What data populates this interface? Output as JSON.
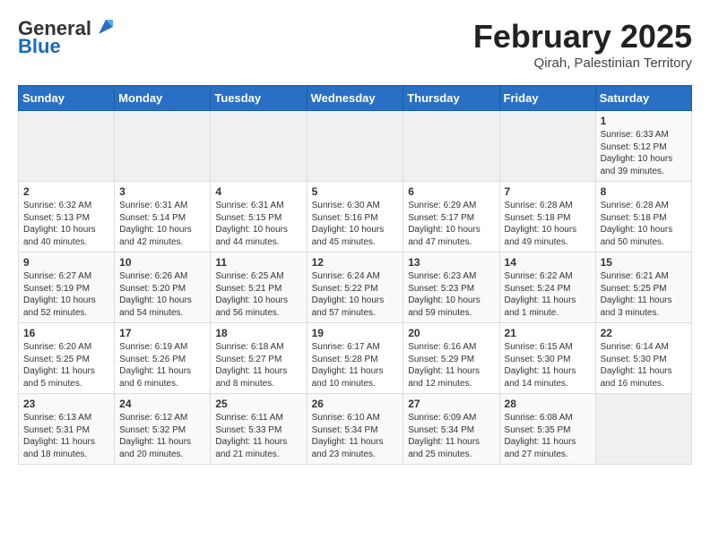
{
  "logo": {
    "general": "General",
    "blue": "Blue"
  },
  "header": {
    "month_year": "February 2025",
    "location": "Qirah, Palestinian Territory"
  },
  "weekdays": [
    "Sunday",
    "Monday",
    "Tuesday",
    "Wednesday",
    "Thursday",
    "Friday",
    "Saturday"
  ],
  "weeks": [
    [
      {
        "day": "",
        "content": ""
      },
      {
        "day": "",
        "content": ""
      },
      {
        "day": "",
        "content": ""
      },
      {
        "day": "",
        "content": ""
      },
      {
        "day": "",
        "content": ""
      },
      {
        "day": "",
        "content": ""
      },
      {
        "day": "1",
        "content": "Sunrise: 6:33 AM\nSunset: 5:12 PM\nDaylight: 10 hours and 39 minutes."
      }
    ],
    [
      {
        "day": "2",
        "content": "Sunrise: 6:32 AM\nSunset: 5:13 PM\nDaylight: 10 hours and 40 minutes."
      },
      {
        "day": "3",
        "content": "Sunrise: 6:31 AM\nSunset: 5:14 PM\nDaylight: 10 hours and 42 minutes."
      },
      {
        "day": "4",
        "content": "Sunrise: 6:31 AM\nSunset: 5:15 PM\nDaylight: 10 hours and 44 minutes."
      },
      {
        "day": "5",
        "content": "Sunrise: 6:30 AM\nSunset: 5:16 PM\nDaylight: 10 hours and 45 minutes."
      },
      {
        "day": "6",
        "content": "Sunrise: 6:29 AM\nSunset: 5:17 PM\nDaylight: 10 hours and 47 minutes."
      },
      {
        "day": "7",
        "content": "Sunrise: 6:28 AM\nSunset: 5:18 PM\nDaylight: 10 hours and 49 minutes."
      },
      {
        "day": "8",
        "content": "Sunrise: 6:28 AM\nSunset: 5:18 PM\nDaylight: 10 hours and 50 minutes."
      }
    ],
    [
      {
        "day": "9",
        "content": "Sunrise: 6:27 AM\nSunset: 5:19 PM\nDaylight: 10 hours and 52 minutes."
      },
      {
        "day": "10",
        "content": "Sunrise: 6:26 AM\nSunset: 5:20 PM\nDaylight: 10 hours and 54 minutes."
      },
      {
        "day": "11",
        "content": "Sunrise: 6:25 AM\nSunset: 5:21 PM\nDaylight: 10 hours and 56 minutes."
      },
      {
        "day": "12",
        "content": "Sunrise: 6:24 AM\nSunset: 5:22 PM\nDaylight: 10 hours and 57 minutes."
      },
      {
        "day": "13",
        "content": "Sunrise: 6:23 AM\nSunset: 5:23 PM\nDaylight: 10 hours and 59 minutes."
      },
      {
        "day": "14",
        "content": "Sunrise: 6:22 AM\nSunset: 5:24 PM\nDaylight: 11 hours and 1 minute."
      },
      {
        "day": "15",
        "content": "Sunrise: 6:21 AM\nSunset: 5:25 PM\nDaylight: 11 hours and 3 minutes."
      }
    ],
    [
      {
        "day": "16",
        "content": "Sunrise: 6:20 AM\nSunset: 5:25 PM\nDaylight: 11 hours and 5 minutes."
      },
      {
        "day": "17",
        "content": "Sunrise: 6:19 AM\nSunset: 5:26 PM\nDaylight: 11 hours and 6 minutes."
      },
      {
        "day": "18",
        "content": "Sunrise: 6:18 AM\nSunset: 5:27 PM\nDaylight: 11 hours and 8 minutes."
      },
      {
        "day": "19",
        "content": "Sunrise: 6:17 AM\nSunset: 5:28 PM\nDaylight: 11 hours and 10 minutes."
      },
      {
        "day": "20",
        "content": "Sunrise: 6:16 AM\nSunset: 5:29 PM\nDaylight: 11 hours and 12 minutes."
      },
      {
        "day": "21",
        "content": "Sunrise: 6:15 AM\nSunset: 5:30 PM\nDaylight: 11 hours and 14 minutes."
      },
      {
        "day": "22",
        "content": "Sunrise: 6:14 AM\nSunset: 5:30 PM\nDaylight: 11 hours and 16 minutes."
      }
    ],
    [
      {
        "day": "23",
        "content": "Sunrise: 6:13 AM\nSunset: 5:31 PM\nDaylight: 11 hours and 18 minutes."
      },
      {
        "day": "24",
        "content": "Sunrise: 6:12 AM\nSunset: 5:32 PM\nDaylight: 11 hours and 20 minutes."
      },
      {
        "day": "25",
        "content": "Sunrise: 6:11 AM\nSunset: 5:33 PM\nDaylight: 11 hours and 21 minutes."
      },
      {
        "day": "26",
        "content": "Sunrise: 6:10 AM\nSunset: 5:34 PM\nDaylight: 11 hours and 23 minutes."
      },
      {
        "day": "27",
        "content": "Sunrise: 6:09 AM\nSunset: 5:34 PM\nDaylight: 11 hours and 25 minutes."
      },
      {
        "day": "28",
        "content": "Sunrise: 6:08 AM\nSunset: 5:35 PM\nDaylight: 11 hours and 27 minutes."
      },
      {
        "day": "",
        "content": ""
      }
    ]
  ]
}
